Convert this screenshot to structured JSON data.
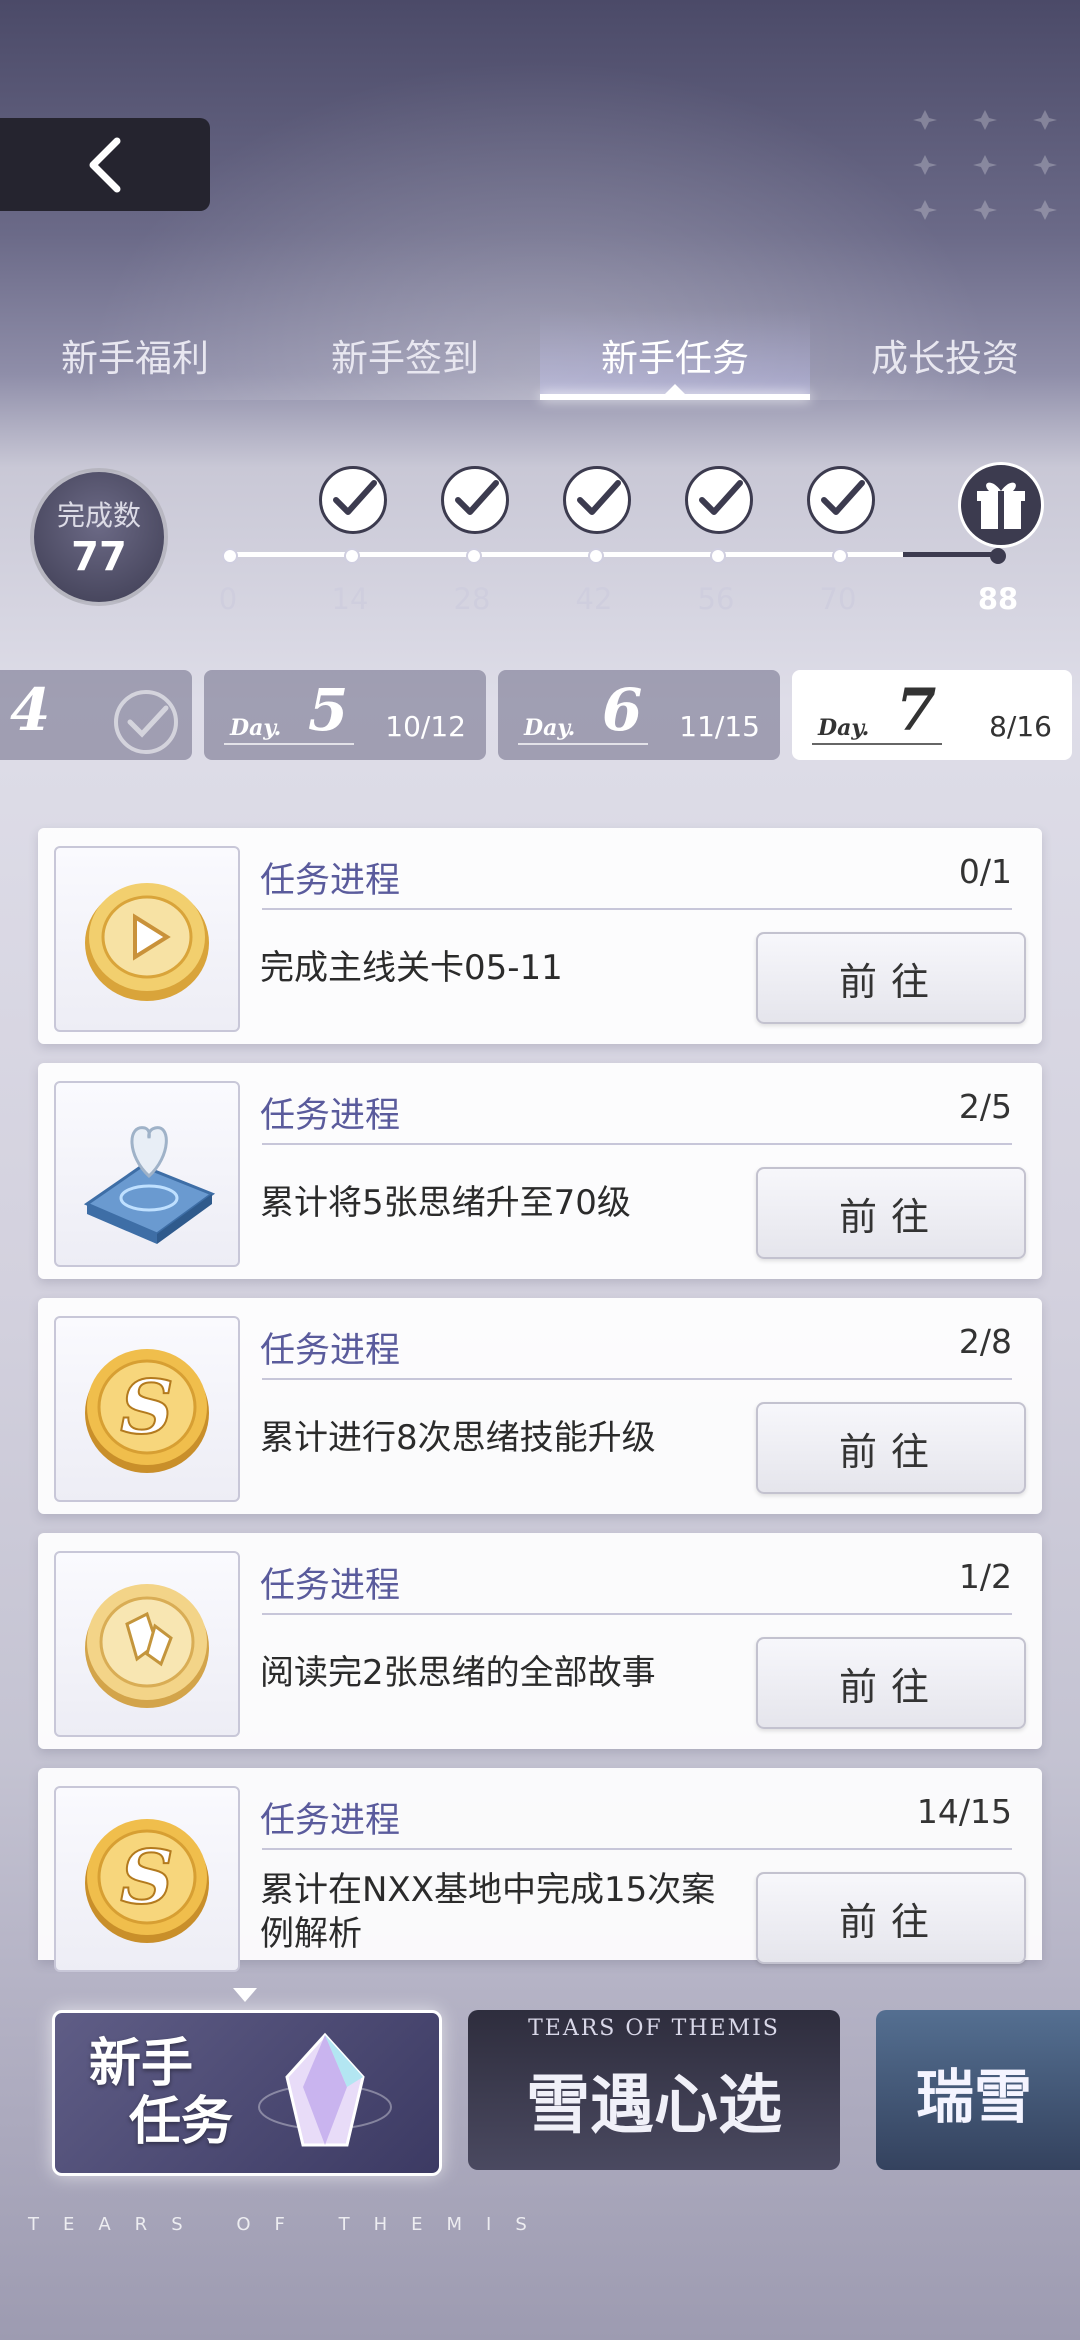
{
  "tabs": [
    "新手福利",
    "新手签到",
    "新手任务",
    "成长投资"
  ],
  "progress": {
    "label": "完成数",
    "count": "77",
    "ticks": [
      "0",
      "14",
      "28",
      "42",
      "56",
      "70",
      "88"
    ]
  },
  "days": [
    {
      "num": "4"
    },
    {
      "label": "Day.",
      "num": "5",
      "count": "10/12"
    },
    {
      "label": "Day.",
      "num": "6",
      "count": "11/15"
    },
    {
      "label": "Day.",
      "num": "7",
      "count": "8/16"
    }
  ],
  "tasks": [
    {
      "label": "任务进程",
      "progress": "0/1",
      "desc": "完成主线关卡05-11",
      "button": "前往",
      "icon": "play-coin-icon"
    },
    {
      "label": "任务进程",
      "progress": "2/5",
      "desc": "累计将5张思绪升至70级",
      "button": "前往",
      "icon": "heart-pedestal-icon"
    },
    {
      "label": "任务进程",
      "progress": "2/8",
      "desc": "累计进行8次思绪技能升级",
      "button": "前往",
      "icon": "s-coin-icon"
    },
    {
      "label": "任务进程",
      "progress": "1/2",
      "desc": "阅读完2张思绪的全部故事",
      "button": "前往",
      "icon": "story-coin-icon"
    },
    {
      "label": "任务进程",
      "progress": "14/15",
      "desc": "累计在NXX基地中完成15次案例解析",
      "button": "前往",
      "icon": "s-coin-icon"
    }
  ],
  "events": [
    {
      "title_line1": "新手",
      "title_line2": "任务"
    },
    {
      "subtitle": "TEARS OF THEMIS",
      "title": "雪遇心选"
    },
    {
      "title": "瑞雪"
    }
  ],
  "brand": "TEARS OF THEMIS",
  "colors": {
    "accent": "#5a5b9c",
    "dark": "#3c3b4f",
    "gold": "#e8b94a"
  }
}
